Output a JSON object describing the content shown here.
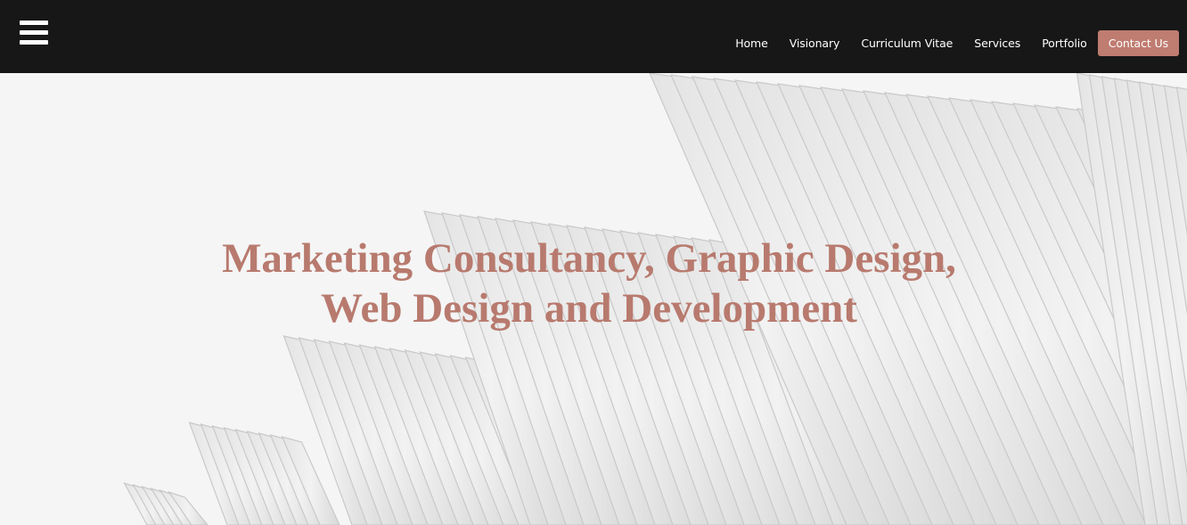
{
  "header": {
    "menu_icon": "hamburger-menu-icon",
    "nav": {
      "home": "Home",
      "visionary": "Visionary",
      "cv": "Curriculum Vitae",
      "services": "Services",
      "portfolio": "Portfolio",
      "contact": "Contact Us"
    }
  },
  "hero": {
    "headline_line1": "Marketing Consultancy, Graphic Design,",
    "headline_line2": "Web Design and Development"
  },
  "colors": {
    "topbar": "#171717",
    "accent": "#bf7c70",
    "headline": "#b87a6e"
  }
}
